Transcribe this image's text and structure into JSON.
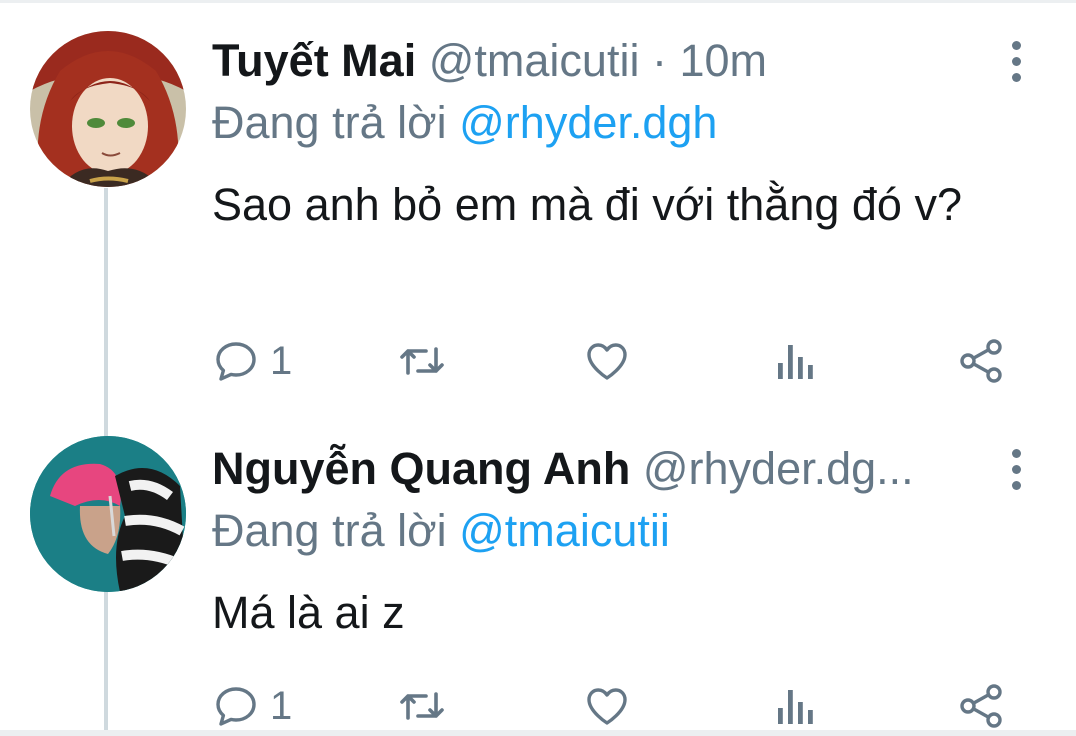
{
  "tweets": [
    {
      "name": "Tuyết Mai",
      "handle": "@tmaicutii",
      "time": "· 10m",
      "reply_prefix": "Đang trả lời",
      "reply_to": "@rhyder.dgh",
      "text": "Sao anh bỏ em mà đi với thằng đó v?",
      "reply_count": "1"
    },
    {
      "name": "Nguyễn Quang Anh",
      "handle": "@rhyder.dg...",
      "time": "",
      "reply_prefix": "Đang trả lời",
      "reply_to": "@tmaicutii",
      "text": "Má là ai z",
      "reply_count": "1"
    }
  ],
  "icons": [
    "reply-icon",
    "retweet-icon",
    "like-icon",
    "analytics-icon",
    "share-icon",
    "more-icon"
  ],
  "colors": {
    "text": "#14171a",
    "muted": "#657786",
    "link": "#1da1f2",
    "thread": "#cfd9de"
  }
}
